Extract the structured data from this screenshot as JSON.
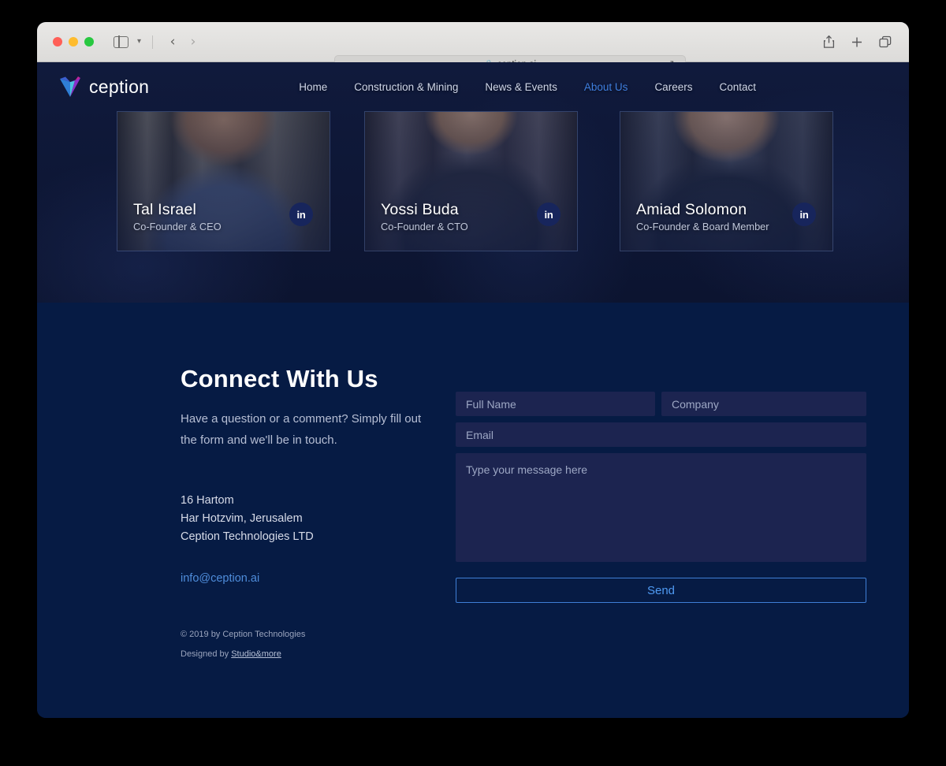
{
  "browser": {
    "url": "ception.ai",
    "lock_icon": "lock-icon",
    "reload_icon": "reload-icon",
    "back_icon": "chevron-left-icon",
    "forward_icon": "chevron-right-icon",
    "sidebar_icon": "sidebar-toggle-icon",
    "share_icon": "share-icon",
    "new_tab_icon": "plus-icon",
    "tab_overview_icon": "tab-overview-icon"
  },
  "site": {
    "logo_text": "ception",
    "nav": [
      {
        "label": "Home",
        "active": false
      },
      {
        "label": "Construction & Mining",
        "active": false
      },
      {
        "label": "News & Events",
        "active": false
      },
      {
        "label": "About Us",
        "active": true
      },
      {
        "label": "Careers",
        "active": false
      },
      {
        "label": "Contact",
        "active": false
      }
    ],
    "team": [
      {
        "name": "Tal Israel",
        "role": "Co-Founder & CEO",
        "social": "in"
      },
      {
        "name": "Yossi Buda",
        "role": "Co-Founder & CTO",
        "social": "in"
      },
      {
        "name": "Amiad Solomon",
        "role": "Co-Founder & Board Member",
        "social": "in"
      }
    ],
    "contact": {
      "title": "Connect With Us",
      "subtitle": "Have a question or a comment? Simply fill out the form and we'll be in touch.",
      "address_line1": "16 Hartom",
      "address_line2": "Har Hotzvim, Jerusalem",
      "address_line3": "Ception Technologies LTD",
      "email": "info@ception.ai"
    },
    "form": {
      "full_name_placeholder": "Full Name",
      "company_placeholder": "Company",
      "email_placeholder": "Email",
      "message_placeholder": "Type your message here",
      "send_label": "Send"
    },
    "footer": {
      "copyright": "© 2019 by Ception Technologies",
      "designed_prefix": "Designed by ",
      "designed_link": "Studio&more"
    },
    "colors": {
      "page_bg": "#0d1533",
      "footer_bg": "#061b44",
      "field_bg": "#1c2450",
      "accent": "#4f9af2",
      "nav_active": "#3f7fe0"
    }
  }
}
